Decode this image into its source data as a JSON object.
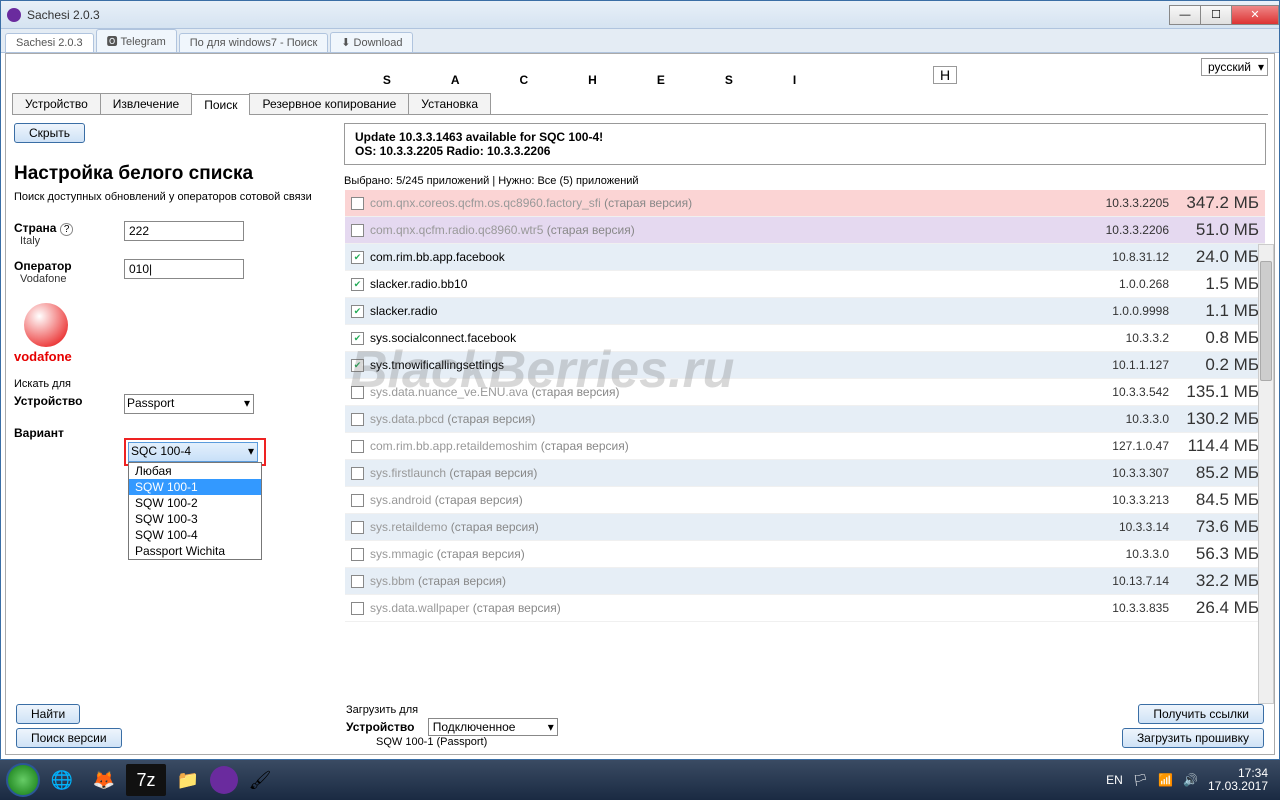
{
  "window": {
    "title": "Sachesi 2.0.3"
  },
  "browser_tabs": [
    "Sachesi 2.0.3",
    "🅾 Telegram",
    "По для windows7 - Поиск",
    "⬇ Download"
  ],
  "app": {
    "title": "SACHESI",
    "title_btn": "H",
    "language": "русский",
    "tabs": [
      "Устройство",
      "Извлечение",
      "Поиск",
      "Резервное копирование",
      "Установка"
    ],
    "active_tab": 2,
    "hide_btn": "Скрыть",
    "update": {
      "l1": "Update 10.3.3.1463 available for SQC 100-4!",
      "l2": "OS: 10.3.3.2205 Radio: 10.3.3.2206"
    },
    "whitelist": {
      "title": "Настройка белого списка",
      "sub": "Поиск доступных обновлений у операторов сотовой связи"
    },
    "country": {
      "label": "Страна",
      "sub": "Italy",
      "value": "222",
      "help": "?"
    },
    "operator": {
      "label": "Оператор",
      "sub": "Vodafone",
      "value": "010|"
    },
    "carrier": "vodafone",
    "search_for": "Искать для",
    "device": {
      "label": "Устройство",
      "value": "Passport"
    },
    "variant": {
      "label": "Вариант",
      "value": "SQC 100-4",
      "options": [
        "Любая",
        "SQW 100-1",
        "SQW 100-2",
        "SQW 100-3",
        "SQW 100-4",
        "Passport Wichita"
      ],
      "highlighted": 1
    },
    "selected_hdr": "Выбрано: 5/245 приложений | Нужно: Все (5) приложений",
    "old_suffix": "(старая версия)",
    "rows": [
      {
        "c": false,
        "n": "com.qnx.coreos.qcfm.os.qc8960.factory_sfi",
        "old": true,
        "v": "10.3.3.2205",
        "s": "347.2 МБ",
        "cls": "pink"
      },
      {
        "c": false,
        "n": "com.qnx.qcfm.radio.qc8960.wtr5",
        "old": true,
        "v": "10.3.3.2206",
        "s": "51.0 МБ",
        "cls": "lav"
      },
      {
        "c": true,
        "n": "com.rim.bb.app.facebook",
        "old": false,
        "v": "10.8.31.12",
        "s": "24.0 МБ",
        "cls": "blue"
      },
      {
        "c": true,
        "n": "slacker.radio.bb10",
        "old": false,
        "v": "1.0.0.268",
        "s": "1.5 МБ",
        "cls": ""
      },
      {
        "c": true,
        "n": "slacker.radio",
        "old": false,
        "v": "1.0.0.9998",
        "s": "1.1 МБ",
        "cls": "blue"
      },
      {
        "c": true,
        "n": "sys.socialconnect.facebook",
        "old": false,
        "v": "10.3.3.2",
        "s": "0.8 МБ",
        "cls": ""
      },
      {
        "c": true,
        "n": "sys.tmowificallingsettings",
        "old": false,
        "v": "10.1.1.127",
        "s": "0.2 МБ",
        "cls": "blue"
      },
      {
        "c": false,
        "n": "sys.data.nuance_ve.ENU.ava",
        "old": true,
        "v": "10.3.3.542",
        "s": "135.1 МБ",
        "cls": ""
      },
      {
        "c": false,
        "n": "sys.data.pbcd",
        "old": true,
        "v": "10.3.3.0",
        "s": "130.2 МБ",
        "cls": "blue"
      },
      {
        "c": false,
        "n": "com.rim.bb.app.retaildemoshim",
        "old": true,
        "v": "127.1.0.47",
        "s": "114.4 МБ",
        "cls": ""
      },
      {
        "c": false,
        "n": "sys.firstlaunch",
        "old": true,
        "v": "10.3.3.307",
        "s": "85.2 МБ",
        "cls": "blue"
      },
      {
        "c": false,
        "n": "sys.android",
        "old": true,
        "v": "10.3.3.213",
        "s": "84.5 МБ",
        "cls": ""
      },
      {
        "c": false,
        "n": "sys.retaildemo",
        "old": true,
        "v": "10.3.3.14",
        "s": "73.6 МБ",
        "cls": "blue"
      },
      {
        "c": false,
        "n": "sys.mmagic",
        "old": true,
        "v": "10.3.3.0",
        "s": "56.3 МБ",
        "cls": ""
      },
      {
        "c": false,
        "n": "sys.bbm",
        "old": true,
        "v": "10.13.7.14",
        "s": "32.2 МБ",
        "cls": "blue"
      },
      {
        "c": false,
        "n": "sys.data.wallpaper",
        "old": true,
        "v": "10.3.3.835",
        "s": "26.4 МБ",
        "cls": ""
      }
    ],
    "footer": {
      "find": "Найти",
      "findver": "Поиск версии",
      "download_for": "Загрузить для",
      "device": "Устройство",
      "device_val": "Подключенное",
      "device_sub": "SQW 100-1 (Passport)",
      "links": "Получить ссылки",
      "firmware": "Загрузить прошивку"
    }
  },
  "watermark": "BlackBerries.ru",
  "tray": {
    "lang": "EN",
    "time": "17:34",
    "date": "17.03.2017"
  }
}
